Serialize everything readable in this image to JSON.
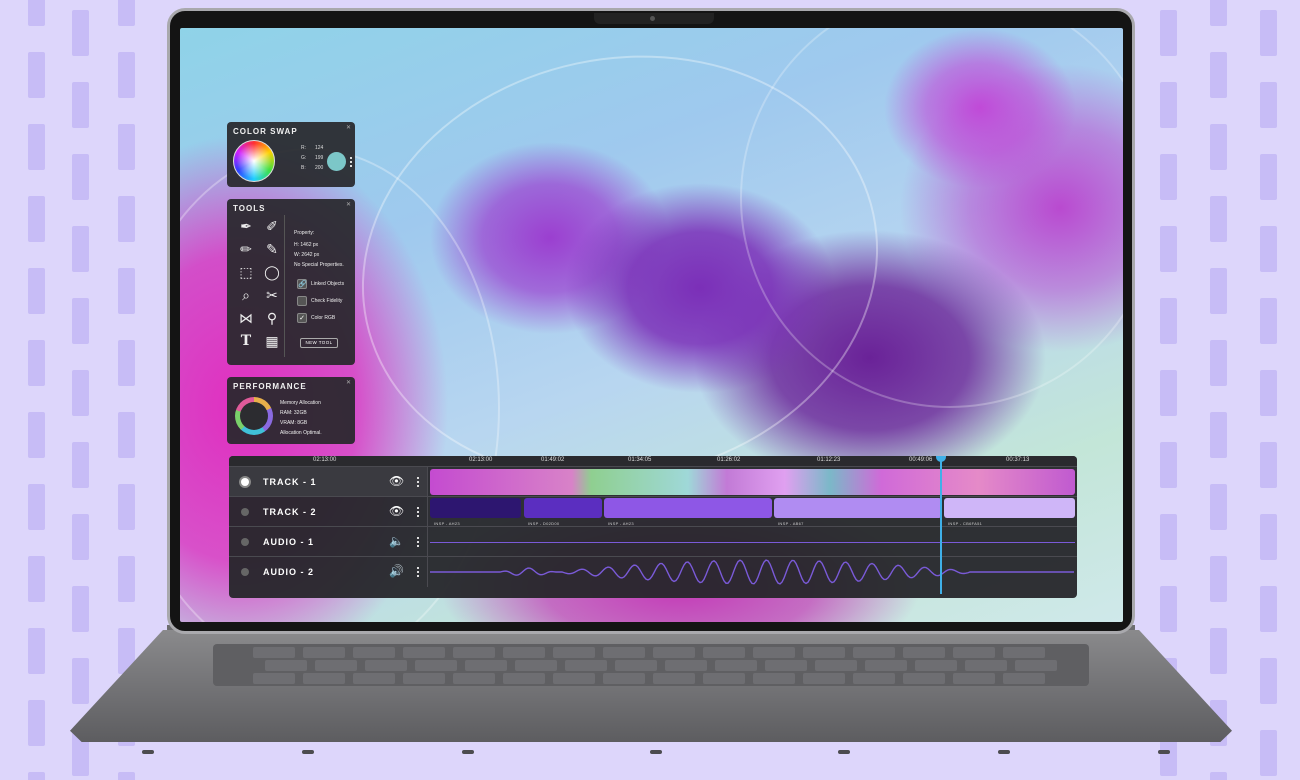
{
  "color_swap": {
    "title": "COLOR SWAP",
    "r_label": "R:",
    "r_value": "124",
    "g_label": "G:",
    "g_value": "199",
    "b_label": "B:",
    "b_value": "200"
  },
  "tools": {
    "title": "TOOLS",
    "icons": [
      "pen-nib-icon",
      "brush-icon",
      "pencil-icon",
      "pen-icon",
      "crop-icon",
      "lasso-icon",
      "magnifier-icon",
      "scissors-icon",
      "flip-icon",
      "dropper-icon",
      "text-icon",
      "gradient-icon"
    ],
    "property_label": "Property:",
    "height": "H: 1462 px",
    "width": "W: 2642 px",
    "no_special": "No Special Properties.",
    "linked_objects": "Linked Objects",
    "check_fidelity": "Check Fidelity",
    "color_rgb": "Color RGB",
    "new_tool": "NEW TOOL"
  },
  "performance": {
    "title": "PERFORMANCE",
    "memory_allocation": "Memory Allocation",
    "ram": "RAM: 32GB",
    "vram": "VRAM: 8GB",
    "status": "Allocation Optimal."
  },
  "timeline": {
    "ruler": [
      "02:13:00",
      "02:13:00",
      "01:49:02",
      "01:34:05",
      "01:26:02",
      "01:12:23",
      "00:49:06",
      "00:37:13"
    ],
    "tracks": [
      {
        "label": "TRACK - 1",
        "icon": "eye-icon"
      },
      {
        "label": "TRACK - 2",
        "icon": "eye-icon"
      },
      {
        "label": "AUDIO - 1",
        "icon": "speaker-icon"
      },
      {
        "label": "AUDIO - 2",
        "icon": "speaker-loud-icon"
      }
    ],
    "clips": [
      {
        "label": "INSP - AH23",
        "color": "#2d1670"
      },
      {
        "label": "INSP - D02D00",
        "color": "#5b2ec0"
      },
      {
        "label": "INSP - AH23",
        "color": "#8e57e6"
      },
      {
        "label": "INSP - AB67",
        "color": "#b08cf2"
      },
      {
        "label": "INSP - CB6FA51",
        "color": "#cfb6f8"
      }
    ],
    "playhead_color": "#3fb0e8"
  },
  "colors": {
    "background": "#ddd6fb",
    "panel": "#28282c",
    "accent": "#3fb0e8",
    "swatch": "#7cc7c8"
  }
}
